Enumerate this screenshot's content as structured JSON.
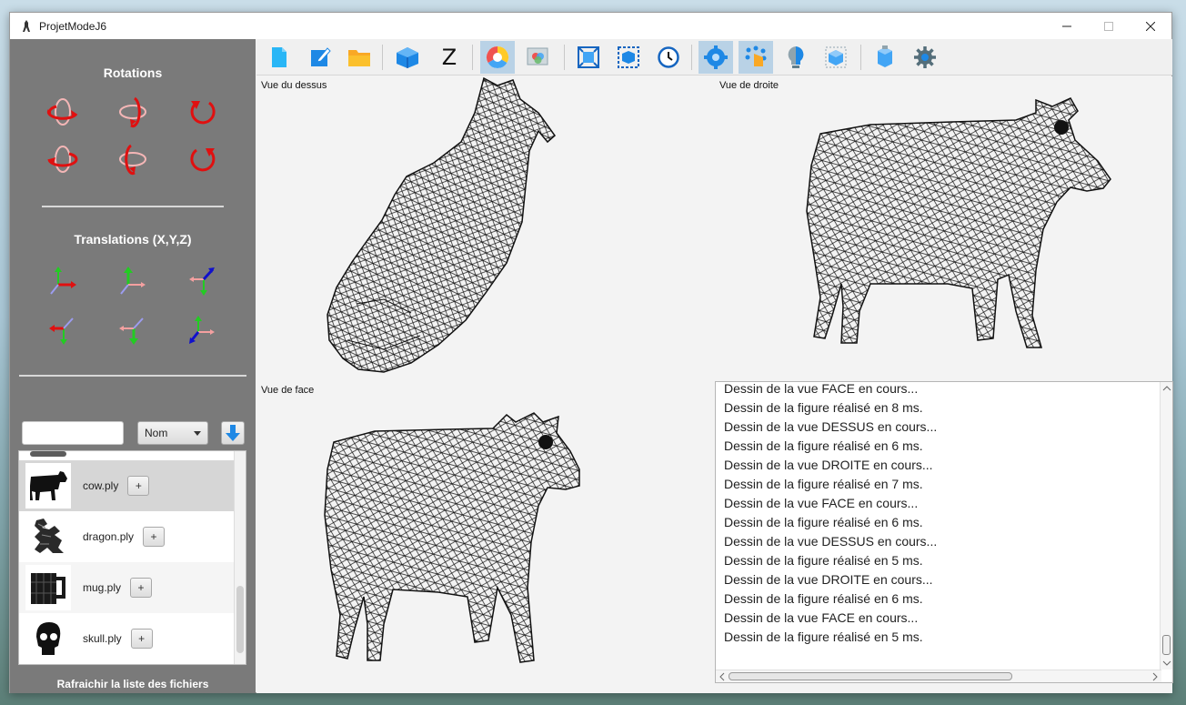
{
  "window": {
    "title": "ProjetModeJ6"
  },
  "sidebar": {
    "rotations_title": "Rotations",
    "translations_title": "Translations (X,Y,Z)",
    "search": {
      "value": "",
      "placeholder": ""
    },
    "sort": {
      "selected": "Nom"
    },
    "files": [
      {
        "name": "cow.ply",
        "add_label": "+",
        "icon": "cow-thumbnail"
      },
      {
        "name": "dragon.ply",
        "add_label": "+",
        "icon": "dragon-thumbnail"
      },
      {
        "name": "mug.ply",
        "add_label": "+",
        "icon": "mug-thumbnail"
      },
      {
        "name": "skull.ply",
        "add_label": "+",
        "icon": "skull-thumbnail"
      }
    ],
    "refresh_label": "Rafraichir la liste des fichiers"
  },
  "toolbar": {
    "z_label": "Z"
  },
  "views": {
    "top": "Vue du dessus",
    "right": "Vue de droite",
    "front": "Vue de face"
  },
  "console": {
    "lines": [
      "Dessin de la vue FACE en cours...",
      "Dessin de la figure réalisé en 8 ms.",
      "Dessin de la vue DESSUS en cours...",
      "Dessin de la figure réalisé en 6 ms.",
      "Dessin de la vue DROITE en cours...",
      "Dessin de la figure réalisé en 7 ms.",
      "Dessin de la vue FACE en cours...",
      "Dessin de la figure réalisé en 6 ms.",
      "Dessin de la vue DESSUS en cours...",
      "Dessin de la figure réalisé en 5 ms.",
      "Dessin de la vue DROITE en cours...",
      "Dessin de la figure réalisé en 6 ms.",
      "Dessin de la vue FACE en cours...",
      "Dessin de la figure réalisé en 5 ms."
    ]
  },
  "colors": {
    "sidebar_bg": "#7a7a7a",
    "accent_blue": "#1e88e5",
    "rotation_red": "#e01010",
    "selected_row": "#d6d6d6"
  }
}
